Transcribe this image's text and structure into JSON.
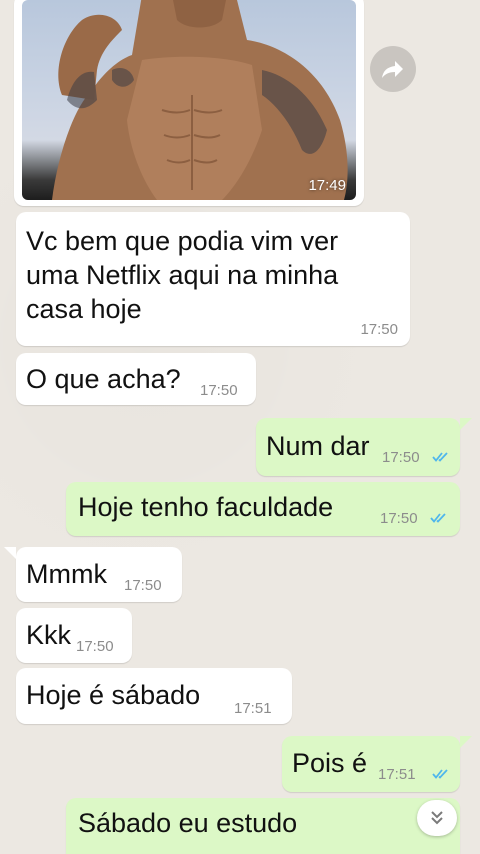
{
  "image_message": {
    "time": "17:49"
  },
  "messages": [
    {
      "lines": [
        "Vc bem que podia vim ver",
        "uma Netflix aqui na minha",
        "casa  hoje"
      ],
      "time": "17:50",
      "direction": "in"
    },
    {
      "text": "O que acha?",
      "time": "17:50",
      "direction": "in"
    },
    {
      "text": "Num dar",
      "time": "17:50",
      "direction": "out",
      "status": "read"
    },
    {
      "text": "Hoje tenho faculdade",
      "time": "17:50",
      "direction": "out",
      "status": "read"
    },
    {
      "text": "Mmmk",
      "time": "17:50",
      "direction": "in"
    },
    {
      "text": "Kkk",
      "time": "17:50",
      "direction": "in"
    },
    {
      "text": "Hoje é sábado",
      "time": "17:51",
      "direction": "in"
    },
    {
      "text": "Pois é",
      "time": "17:51",
      "direction": "out",
      "status": "read"
    },
    {
      "text": "Sábado eu estudo",
      "direction": "out"
    }
  ],
  "icons": {
    "forward": "forward-icon",
    "read_ticks": "double-check-icon",
    "scroll_down": "double-chevron-down-icon"
  },
  "colors": {
    "incoming_bubble": "#ffffff",
    "outgoing_bubble": "#dcf8c6",
    "read_ticks": "#4fb6ec",
    "background": "#ece8e2"
  }
}
